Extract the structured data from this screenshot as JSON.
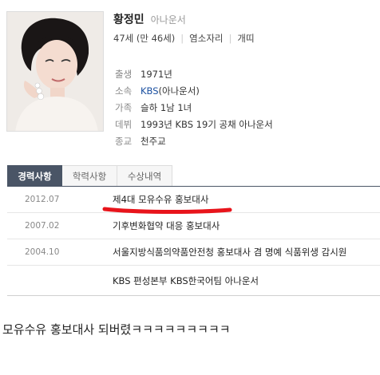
{
  "profile": {
    "name": "황정민",
    "job": "아나운서",
    "age": "47세 (만 46세)",
    "zodiac": "염소자리",
    "animal": "개띠"
  },
  "info": [
    {
      "label": "출생",
      "value": "1971년"
    },
    {
      "label": "소속",
      "value": "KBS",
      "suffix": "(아나운서)"
    },
    {
      "label": "가족",
      "value": "슬하 1남 1녀"
    },
    {
      "label": "데뷔",
      "value": "1993년 KBS 19기 공채 아나운서"
    },
    {
      "label": "종교",
      "value": "천주교"
    }
  ],
  "tabs": [
    {
      "label": "경력사항",
      "active": true
    },
    {
      "label": "학력사항",
      "active": false
    },
    {
      "label": "수상내역",
      "active": false
    }
  ],
  "career": [
    {
      "date": "2012.07",
      "text": "제4대 모유수유 홍보대사",
      "highlighted": true
    },
    {
      "date": "2007.02",
      "text": "기후변화협약 대응 홍보대사"
    },
    {
      "date": "2004.10",
      "text": "서울지방식품의약품안전청 홍보대사 겸 명예 식품위생 감시원"
    },
    {
      "date": "",
      "text": "KBS 편성본부 KBS한국어팀 아나운서"
    }
  ],
  "caption": "모유수유 홍보대사 되버렸ㅋㅋㅋㅋㅋㅋㅋㅋㅋ",
  "colors": {
    "tab_active_bg": "#4a5566",
    "link": "#1a4fa0",
    "highlight_stroke": "#e8141b"
  },
  "icons": {
    "profile_photo": "person-portrait"
  }
}
